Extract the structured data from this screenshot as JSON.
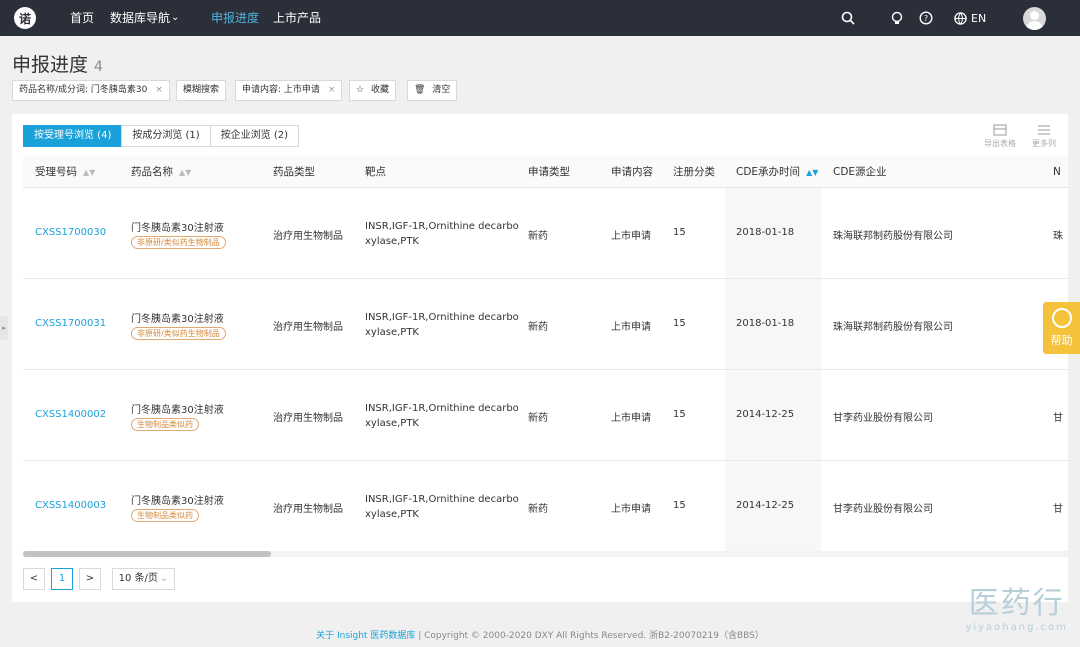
{
  "nav": {
    "logo_glyph": "诺",
    "items": [
      "首页",
      "数据库导航",
      "申报进度",
      "上市产品"
    ],
    "dropdown_caret": "⌄",
    "lang": "EN"
  },
  "page": {
    "title": "申报进度",
    "count": "4"
  },
  "filters": {
    "drug_chip": "药品名称/成分词: 门冬胰岛素30",
    "fuzzy_search": "模糊搜索",
    "content_chip": "申请内容: 上市申请",
    "favorite": "收藏",
    "clear": "清空",
    "close_glyph": "×"
  },
  "tabs": [
    "按受理号浏览 (4)",
    "按成分浏览 (1)",
    "按企业浏览 (2)"
  ],
  "tools": {
    "export": "导出表格",
    "more": "更多列"
  },
  "table": {
    "headers": [
      "受理号码",
      "药品名称",
      "药品类型",
      "靶点",
      "申请类型",
      "申请内容",
      "注册分类",
      "CDE承办时间",
      "CDE源企业",
      "N"
    ],
    "sort_glyph": "▲▼",
    "rows": [
      {
        "id": "CXSS1700030",
        "name": "门冬胰岛素30注射液",
        "badge": "非原研/类似药生物制品",
        "type": "治疗用生物制品",
        "target_line1": "INSR,IGF-1R,Ornithine decarbo",
        "target_line2": "xylase,PTK",
        "app_type": "新药",
        "content": "上市申请",
        "reg_class": "15",
        "date": "2018-01-18",
        "company": "珠海联邦制药股份有限公司",
        "next": "珠"
      },
      {
        "id": "CXSS1700031",
        "name": "门冬胰岛素30注射液",
        "badge": "非原研/类似药生物制品",
        "type": "治疗用生物制品",
        "target_line1": "INSR,IGF-1R,Ornithine decarbo",
        "target_line2": "xylase,PTK",
        "app_type": "新药",
        "content": "上市申请",
        "reg_class": "15",
        "date": "2018-01-18",
        "company": "珠海联邦制药股份有限公司",
        "next": ""
      },
      {
        "id": "CXSS1400002",
        "name": "门冬胰岛素30注射液",
        "badge": "生物制品类似药",
        "type": "治疗用生物制品",
        "target_line1": "INSR,IGF-1R,Ornithine decarbo",
        "target_line2": "xylase,PTK",
        "app_type": "新药",
        "content": "上市申请",
        "reg_class": "15",
        "date": "2014-12-25",
        "company": "甘李药业股份有限公司",
        "next": "甘"
      },
      {
        "id": "CXSS1400003",
        "name": "门冬胰岛素30注射液",
        "badge": "生物制品类似药",
        "type": "治疗用生物制品",
        "target_line1": "INSR,IGF-1R,Ornithine decarbo",
        "target_line2": "xylase,PTK",
        "app_type": "新药",
        "content": "上市申请",
        "reg_class": "15",
        "date": "2014-12-25",
        "company": "甘李药业股份有限公司",
        "next": "甘"
      }
    ]
  },
  "pagination": {
    "prev": "<",
    "current": "1",
    "next": ">",
    "page_size": "10 条/页"
  },
  "footer": {
    "link": "关于 Insight 医药数据库",
    "text": " | Copyright © 2000-2020 DXY All Rights Reserved. 浙B2-20070219（含BBS）"
  },
  "help": {
    "label": "帮助"
  },
  "side_toggle": {
    "glyph": "▸"
  },
  "watermark": {
    "cn": "医药行",
    "en": "yiyaohang.com"
  },
  "colors": {
    "nav_bg": "#2b2f3a",
    "accent": "#1aa1d9",
    "help_bg": "#f5c33b",
    "badge": "#d48a3f"
  },
  "icons": [
    "logo-icon",
    "search-icon",
    "lightbulb-icon",
    "question-icon",
    "globe-icon",
    "avatar-icon",
    "star-icon",
    "trash-icon",
    "export-icon",
    "more-columns-icon",
    "help-icon"
  ]
}
